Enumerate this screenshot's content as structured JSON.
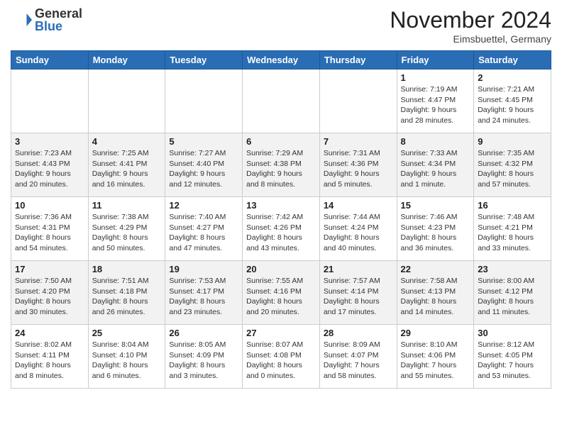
{
  "header": {
    "logo_general": "General",
    "logo_blue": "Blue",
    "month_year": "November 2024",
    "location": "Eimsbuettel, Germany"
  },
  "days_of_week": [
    "Sunday",
    "Monday",
    "Tuesday",
    "Wednesday",
    "Thursday",
    "Friday",
    "Saturday"
  ],
  "weeks": [
    [
      {
        "day": "",
        "info": ""
      },
      {
        "day": "",
        "info": ""
      },
      {
        "day": "",
        "info": ""
      },
      {
        "day": "",
        "info": ""
      },
      {
        "day": "",
        "info": ""
      },
      {
        "day": "1",
        "info": "Sunrise: 7:19 AM\nSunset: 4:47 PM\nDaylight: 9 hours and 28 minutes."
      },
      {
        "day": "2",
        "info": "Sunrise: 7:21 AM\nSunset: 4:45 PM\nDaylight: 9 hours and 24 minutes."
      }
    ],
    [
      {
        "day": "3",
        "info": "Sunrise: 7:23 AM\nSunset: 4:43 PM\nDaylight: 9 hours and 20 minutes."
      },
      {
        "day": "4",
        "info": "Sunrise: 7:25 AM\nSunset: 4:41 PM\nDaylight: 9 hours and 16 minutes."
      },
      {
        "day": "5",
        "info": "Sunrise: 7:27 AM\nSunset: 4:40 PM\nDaylight: 9 hours and 12 minutes."
      },
      {
        "day": "6",
        "info": "Sunrise: 7:29 AM\nSunset: 4:38 PM\nDaylight: 9 hours and 8 minutes."
      },
      {
        "day": "7",
        "info": "Sunrise: 7:31 AM\nSunset: 4:36 PM\nDaylight: 9 hours and 5 minutes."
      },
      {
        "day": "8",
        "info": "Sunrise: 7:33 AM\nSunset: 4:34 PM\nDaylight: 9 hours and 1 minute."
      },
      {
        "day": "9",
        "info": "Sunrise: 7:35 AM\nSunset: 4:32 PM\nDaylight: 8 hours and 57 minutes."
      }
    ],
    [
      {
        "day": "10",
        "info": "Sunrise: 7:36 AM\nSunset: 4:31 PM\nDaylight: 8 hours and 54 minutes."
      },
      {
        "day": "11",
        "info": "Sunrise: 7:38 AM\nSunset: 4:29 PM\nDaylight: 8 hours and 50 minutes."
      },
      {
        "day": "12",
        "info": "Sunrise: 7:40 AM\nSunset: 4:27 PM\nDaylight: 8 hours and 47 minutes."
      },
      {
        "day": "13",
        "info": "Sunrise: 7:42 AM\nSunset: 4:26 PM\nDaylight: 8 hours and 43 minutes."
      },
      {
        "day": "14",
        "info": "Sunrise: 7:44 AM\nSunset: 4:24 PM\nDaylight: 8 hours and 40 minutes."
      },
      {
        "day": "15",
        "info": "Sunrise: 7:46 AM\nSunset: 4:23 PM\nDaylight: 8 hours and 36 minutes."
      },
      {
        "day": "16",
        "info": "Sunrise: 7:48 AM\nSunset: 4:21 PM\nDaylight: 8 hours and 33 minutes."
      }
    ],
    [
      {
        "day": "17",
        "info": "Sunrise: 7:50 AM\nSunset: 4:20 PM\nDaylight: 8 hours and 30 minutes."
      },
      {
        "day": "18",
        "info": "Sunrise: 7:51 AM\nSunset: 4:18 PM\nDaylight: 8 hours and 26 minutes."
      },
      {
        "day": "19",
        "info": "Sunrise: 7:53 AM\nSunset: 4:17 PM\nDaylight: 8 hours and 23 minutes."
      },
      {
        "day": "20",
        "info": "Sunrise: 7:55 AM\nSunset: 4:16 PM\nDaylight: 8 hours and 20 minutes."
      },
      {
        "day": "21",
        "info": "Sunrise: 7:57 AM\nSunset: 4:14 PM\nDaylight: 8 hours and 17 minutes."
      },
      {
        "day": "22",
        "info": "Sunrise: 7:58 AM\nSunset: 4:13 PM\nDaylight: 8 hours and 14 minutes."
      },
      {
        "day": "23",
        "info": "Sunrise: 8:00 AM\nSunset: 4:12 PM\nDaylight: 8 hours and 11 minutes."
      }
    ],
    [
      {
        "day": "24",
        "info": "Sunrise: 8:02 AM\nSunset: 4:11 PM\nDaylight: 8 hours and 8 minutes."
      },
      {
        "day": "25",
        "info": "Sunrise: 8:04 AM\nSunset: 4:10 PM\nDaylight: 8 hours and 6 minutes."
      },
      {
        "day": "26",
        "info": "Sunrise: 8:05 AM\nSunset: 4:09 PM\nDaylight: 8 hours and 3 minutes."
      },
      {
        "day": "27",
        "info": "Sunrise: 8:07 AM\nSunset: 4:08 PM\nDaylight: 8 hours and 0 minutes."
      },
      {
        "day": "28",
        "info": "Sunrise: 8:09 AM\nSunset: 4:07 PM\nDaylight: 7 hours and 58 minutes."
      },
      {
        "day": "29",
        "info": "Sunrise: 8:10 AM\nSunset: 4:06 PM\nDaylight: 7 hours and 55 minutes."
      },
      {
        "day": "30",
        "info": "Sunrise: 8:12 AM\nSunset: 4:05 PM\nDaylight: 7 hours and 53 minutes."
      }
    ]
  ]
}
